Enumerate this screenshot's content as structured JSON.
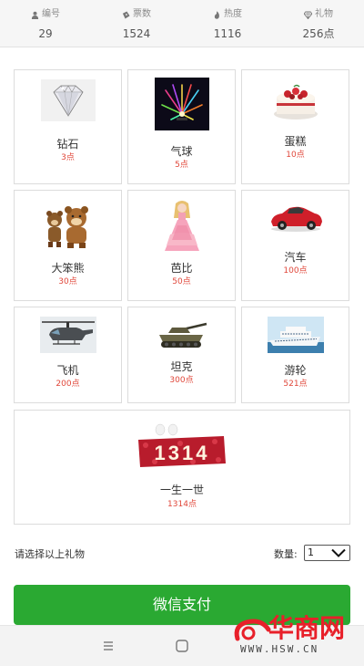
{
  "stats": [
    {
      "label": "编号",
      "value": "29",
      "icon": "user-icon"
    },
    {
      "label": "票数",
      "value": "1524",
      "icon": "ticket-icon"
    },
    {
      "label": "热度",
      "value": "1116",
      "icon": "flame-icon"
    },
    {
      "label": "礼物",
      "value": "256点",
      "icon": "diamond-icon"
    }
  ],
  "gifts": [
    {
      "name": "钻石",
      "price": "3点",
      "icon": "diamond-gift"
    },
    {
      "name": "气球",
      "price": "5点",
      "icon": "fireworks-gift"
    },
    {
      "name": "蛋糕",
      "price": "10点",
      "icon": "cake-gift"
    },
    {
      "name": "大笨熊",
      "price": "30点",
      "icon": "bears-gift"
    },
    {
      "name": "芭比",
      "price": "50点",
      "icon": "doll-gift"
    },
    {
      "name": "汽车",
      "price": "100点",
      "icon": "car-gift"
    },
    {
      "name": "飞机",
      "price": "200点",
      "icon": "helicopter-gift"
    },
    {
      "name": "坦克",
      "price": "300点",
      "icon": "tank-gift"
    },
    {
      "name": "游轮",
      "price": "521点",
      "icon": "cruise-gift"
    },
    {
      "name": "一生一世",
      "price": "1314点",
      "icon": "roses-1314-gift",
      "image_text": "1314"
    }
  ],
  "select_hint": "请选择以上礼物",
  "quantity": {
    "label": "数量:",
    "value": "1"
  },
  "pay_button": "微信支付",
  "watermark": {
    "name": "华商网",
    "url": "WWW.HSW.CN"
  },
  "colors": {
    "accent_green": "#2aa932",
    "price_red": "#e0473a"
  }
}
